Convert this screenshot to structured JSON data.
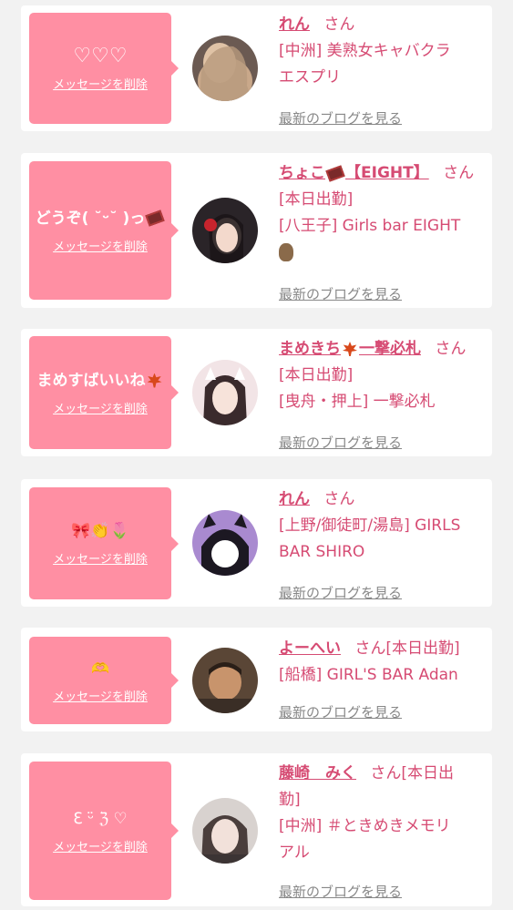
{
  "items": [
    {
      "message": "♡♡♡",
      "delete_label": "メッセージを削除",
      "name": "れん",
      "san": "さん",
      "lines": [
        "[中洲] 美熟女キャバクラ",
        "エスプリ"
      ],
      "blog_label": "最新のブログを見る"
    },
    {
      "message": "どうぞ( ˘ᵕ˘ )っ",
      "delete_label": "メッセージを削除",
      "name": "ちょこ",
      "name_suffix": "【EIGHT】",
      "san": "さん",
      "lines": [
        "[本日出勤]",
        "[八王子] Girls bar EIGHT"
      ],
      "blog_label": "最新のブログを見る"
    },
    {
      "message": "まめすばいいね",
      "delete_label": "メッセージを削除",
      "name": "まめきち",
      "name_suffix": "一撃必札",
      "san": "さん",
      "lines": [
        "[本日出勤]",
        "[曳舟・押上] 一撃必札"
      ],
      "blog_label": "最新のブログを見る"
    },
    {
      "message": "🎀👏🌷",
      "delete_label": "メッセージを削除",
      "name": "れん",
      "san": "さん",
      "lines": [
        "[上野/御徒町/湯島] GIRLS",
        "BAR SHIRO"
      ],
      "blog_label": "最新のブログを見る"
    },
    {
      "message": "🫶",
      "delete_label": "メッセージを削除",
      "name": "よーへい",
      "san": "さん[本日出勤]",
      "lines": [
        "[船橋] GIRL'S BAR Adan"
      ],
      "blog_label": "最新のブログを見る"
    },
    {
      "message": "ℇ ᵕ̈ ℨ ♡",
      "delete_label": "メッセージを削除",
      "name": "藤崎　みく",
      "san": "さん[本日出",
      "lines": [
        "勤]",
        "[中洲] ＃ときめきメモリ",
        "アル"
      ],
      "blog_label": "最新のブログを見る"
    }
  ],
  "colors": {
    "bubble": "#ff8fa3",
    "accent_text": "#d64b73",
    "link_gray": "#888888",
    "page_bg": "#f2f2f2"
  }
}
